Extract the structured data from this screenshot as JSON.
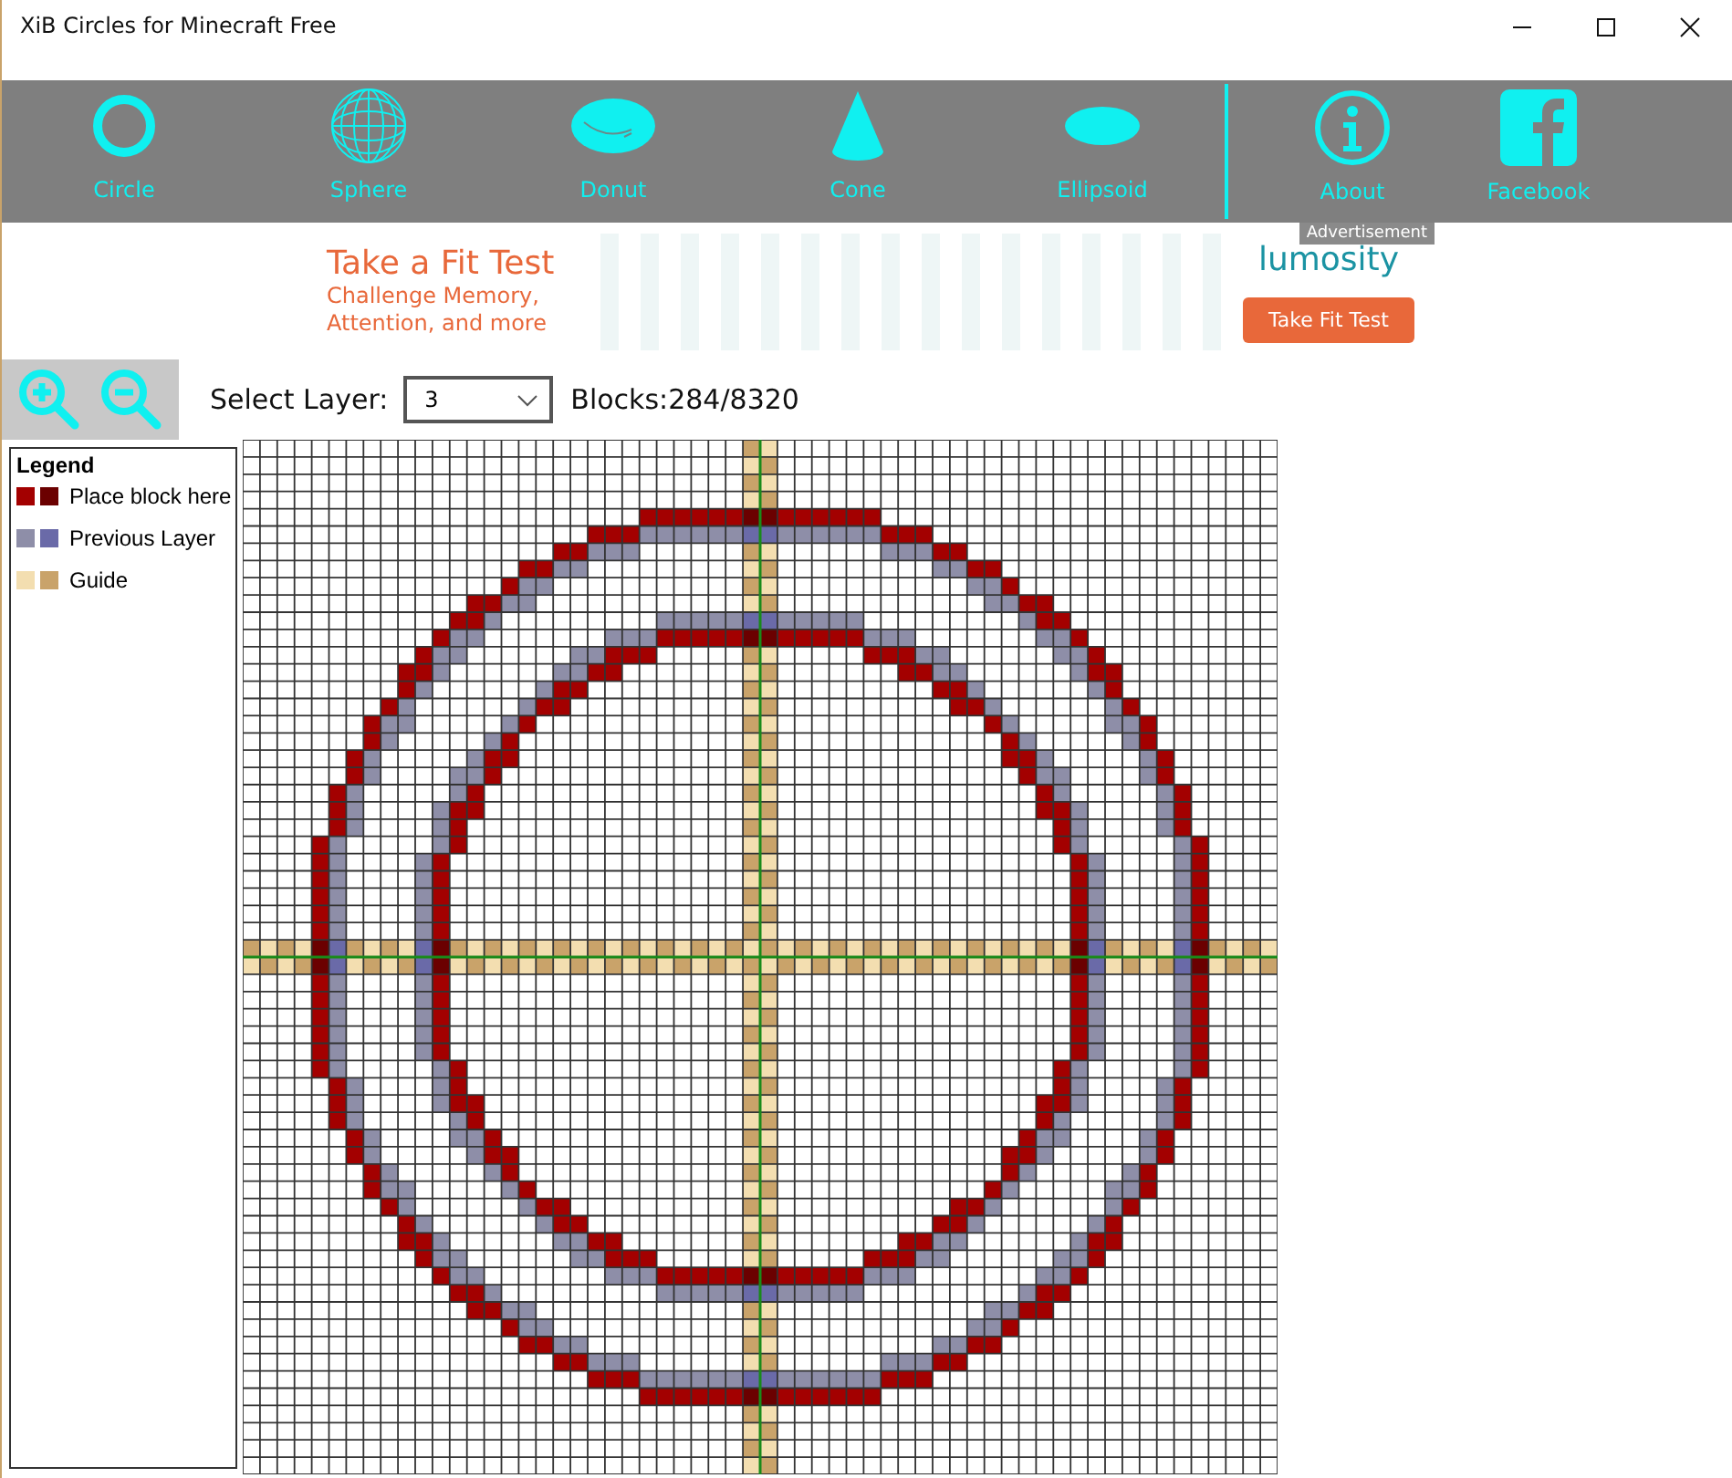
{
  "window": {
    "title": "XiB Circles for Minecraft Free"
  },
  "toolbar": {
    "items": [
      {
        "kind": "circle",
        "label": "Circle"
      },
      {
        "kind": "sphere",
        "label": "Sphere"
      },
      {
        "kind": "donut",
        "label": "Donut"
      },
      {
        "kind": "cone",
        "label": "Cone"
      },
      {
        "kind": "ellipsoid",
        "label": "Ellipsoid"
      }
    ],
    "extra_items": [
      {
        "kind": "info",
        "label": "About"
      },
      {
        "kind": "facebook",
        "label": "Facebook"
      }
    ]
  },
  "ad": {
    "headline": "Take a Fit Test",
    "subline": "Challenge Memory, Attention, and more",
    "brand": "lumosity",
    "button": "Take Fit Test",
    "tag": "Advertisement"
  },
  "layer": {
    "label": "Select Layer:",
    "value": "3",
    "blocks": "Blocks:284/8320"
  },
  "legend": {
    "title": "Legend",
    "items": [
      {
        "kind": "place",
        "label": "Place block here",
        "swatches": [
          {
            "color": "#a30000"
          },
          {
            "color": "#6b0000"
          }
        ]
      },
      {
        "kind": "previous",
        "label": "Previous Layer",
        "swatches": [
          {
            "color": "#8e8ea8"
          },
          {
            "color": "#6a6aa8"
          }
        ]
      },
      {
        "kind": "guide",
        "label": "Guide",
        "swatches": [
          {
            "color": "#f3deb0"
          },
          {
            "color": "#c9a36a"
          }
        ]
      }
    ]
  }
}
